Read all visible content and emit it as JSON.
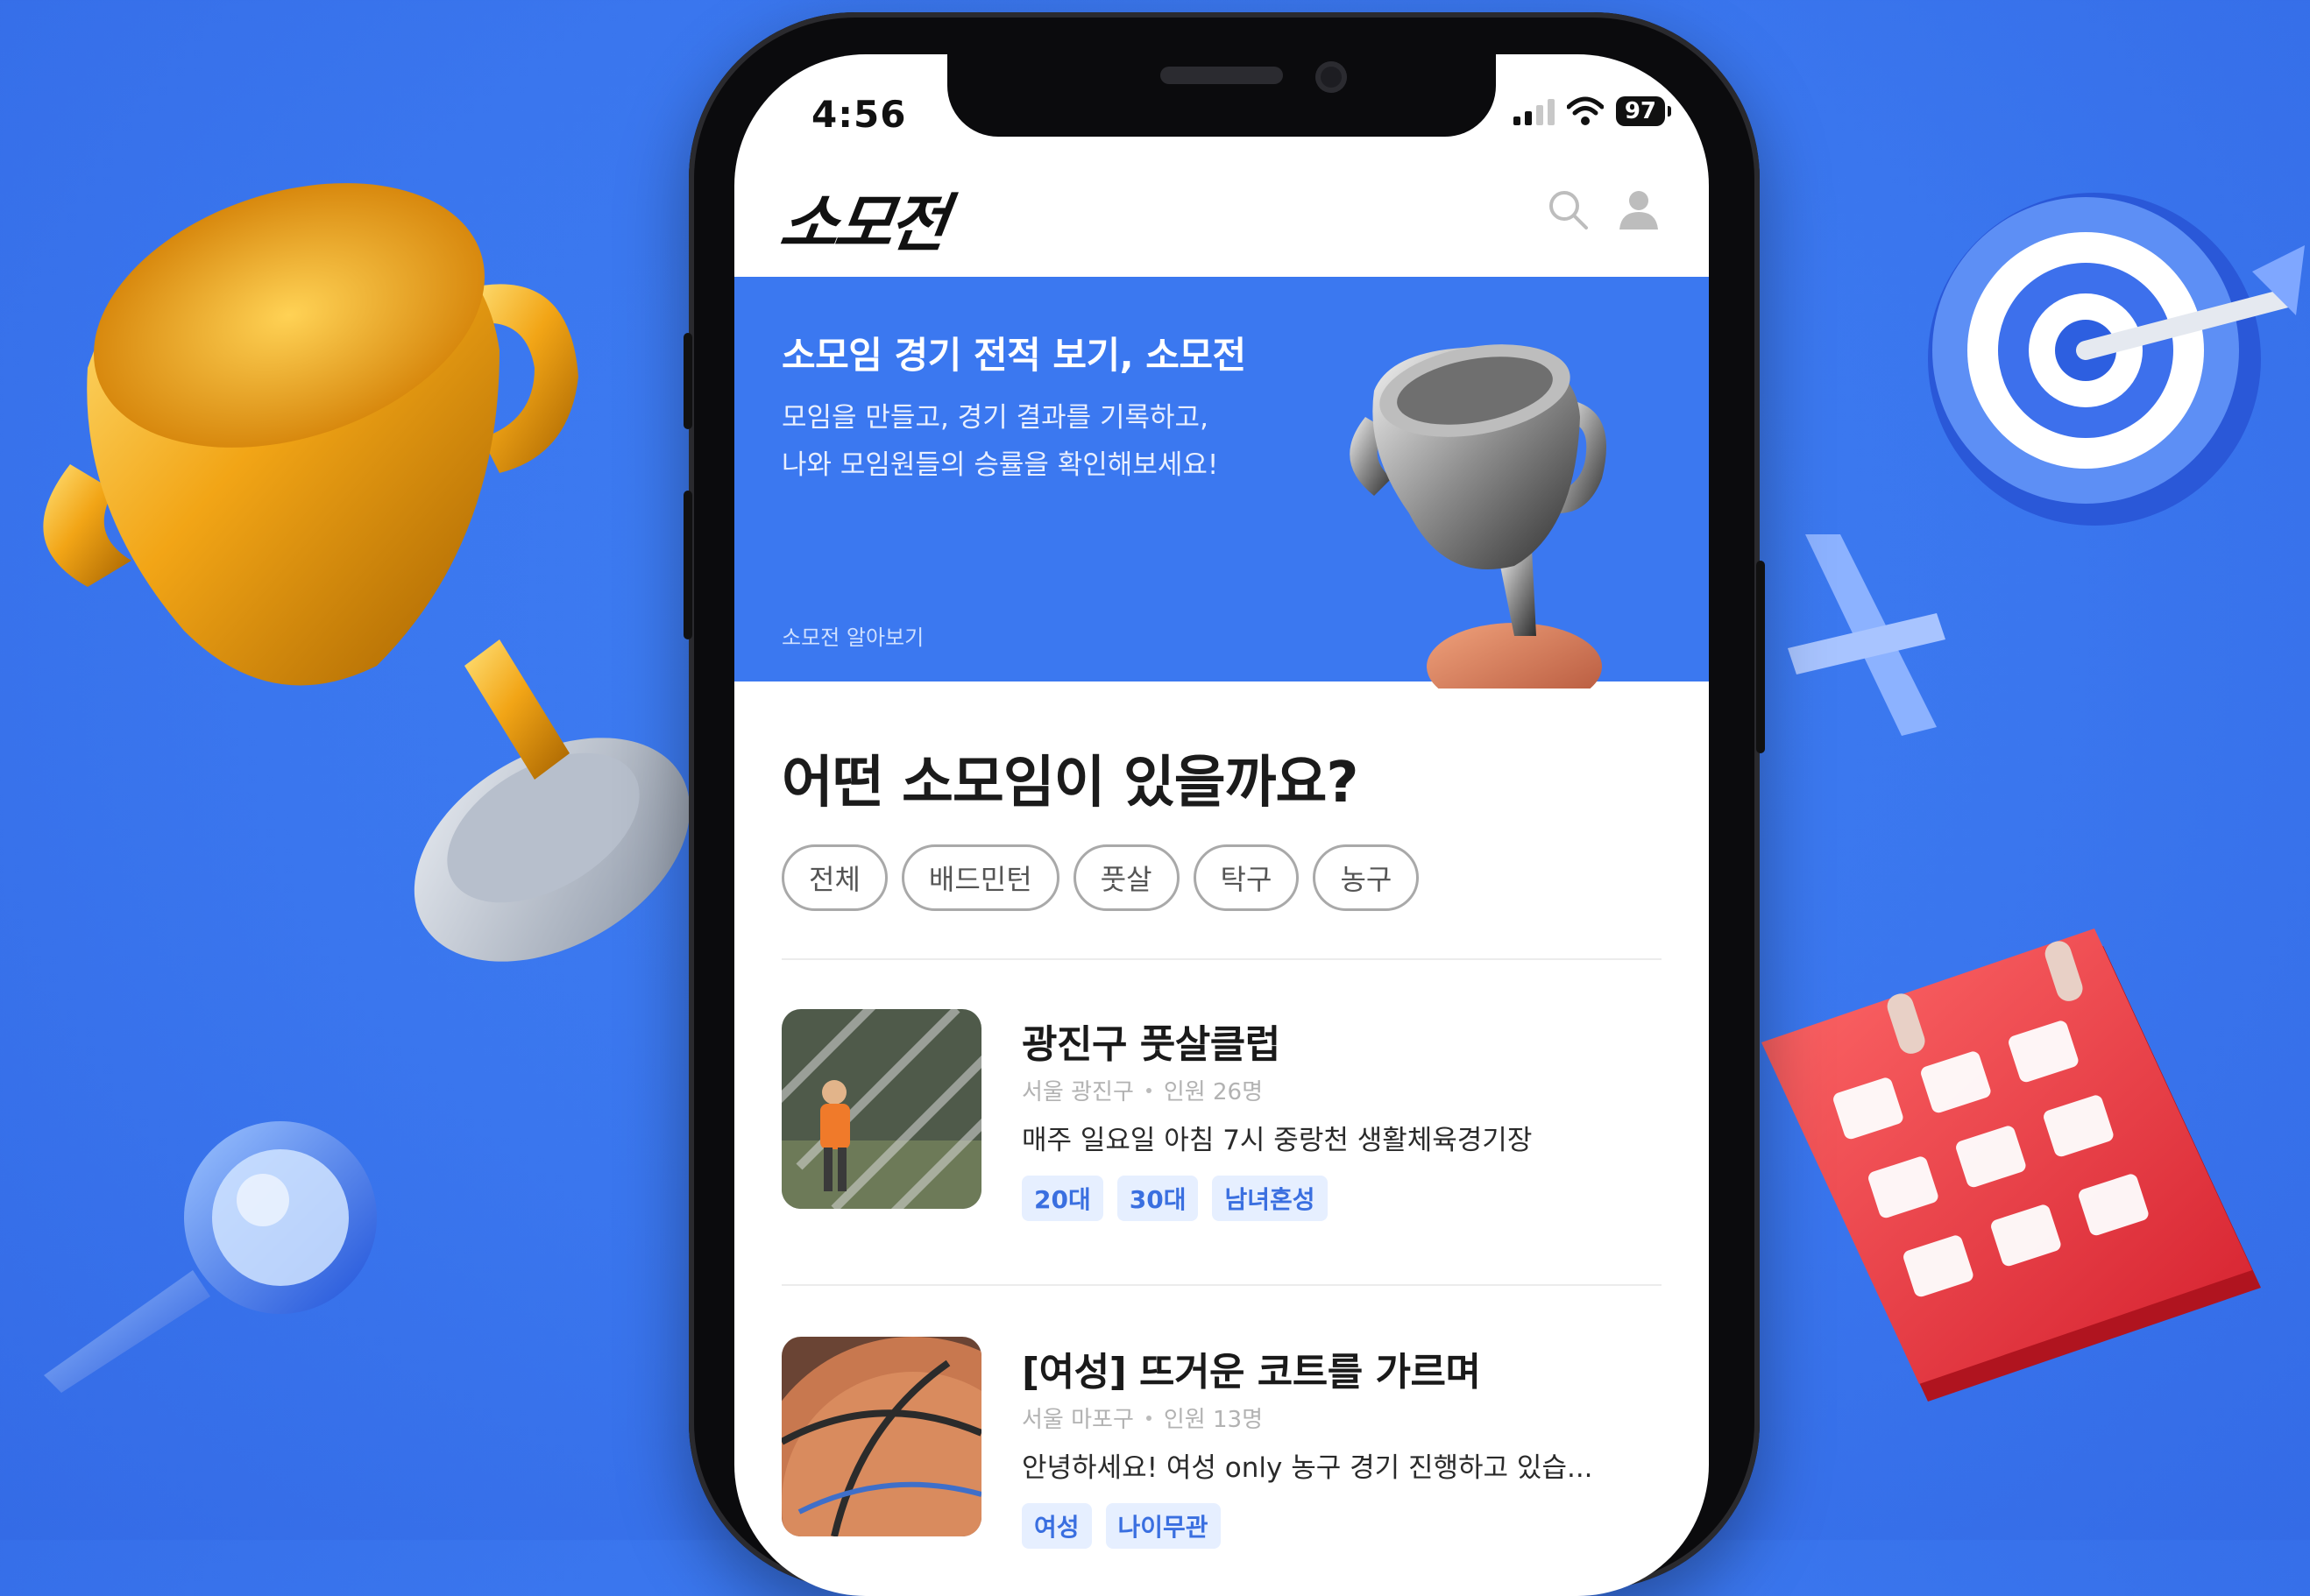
{
  "status_bar": {
    "time": "4:56",
    "battery": "97"
  },
  "app": {
    "logo": "소모전"
  },
  "banner": {
    "title": "소모임 경기 전적 보기, 소모전",
    "description": "모임을 만들고, 경기 결과를 기록하고,\n나와 모임원들의 승률을 확인해보세요!",
    "link": "소모전 알아보기"
  },
  "section": {
    "title": "어떤 소모임이 있을까요?",
    "chips": [
      "전체",
      "배드민턴",
      "풋살",
      "탁구",
      "농구"
    ]
  },
  "clubs": [
    {
      "title": "광진구 풋살클럽",
      "location": "서울 광진구",
      "members": "인원 26명",
      "description": "매주 일요일 아침 7시 중랑천 생활체육경기장",
      "tags": [
        "20대",
        "30대",
        "남녀혼성"
      ]
    },
    {
      "title": "[여성] 뜨거운 코트를 가르며",
      "location": "서울 마포구",
      "members": "인원 13명",
      "description": "안녕하세요! 여성 only 농구 경기 진행하고 있습...",
      "tags": [
        "여성",
        "나이무관"
      ]
    }
  ],
  "colors": {
    "background": "#3a76ee",
    "banner": "#3b78f0",
    "tag_bg": "#e6efff",
    "tag_text": "#3a6fe0"
  }
}
